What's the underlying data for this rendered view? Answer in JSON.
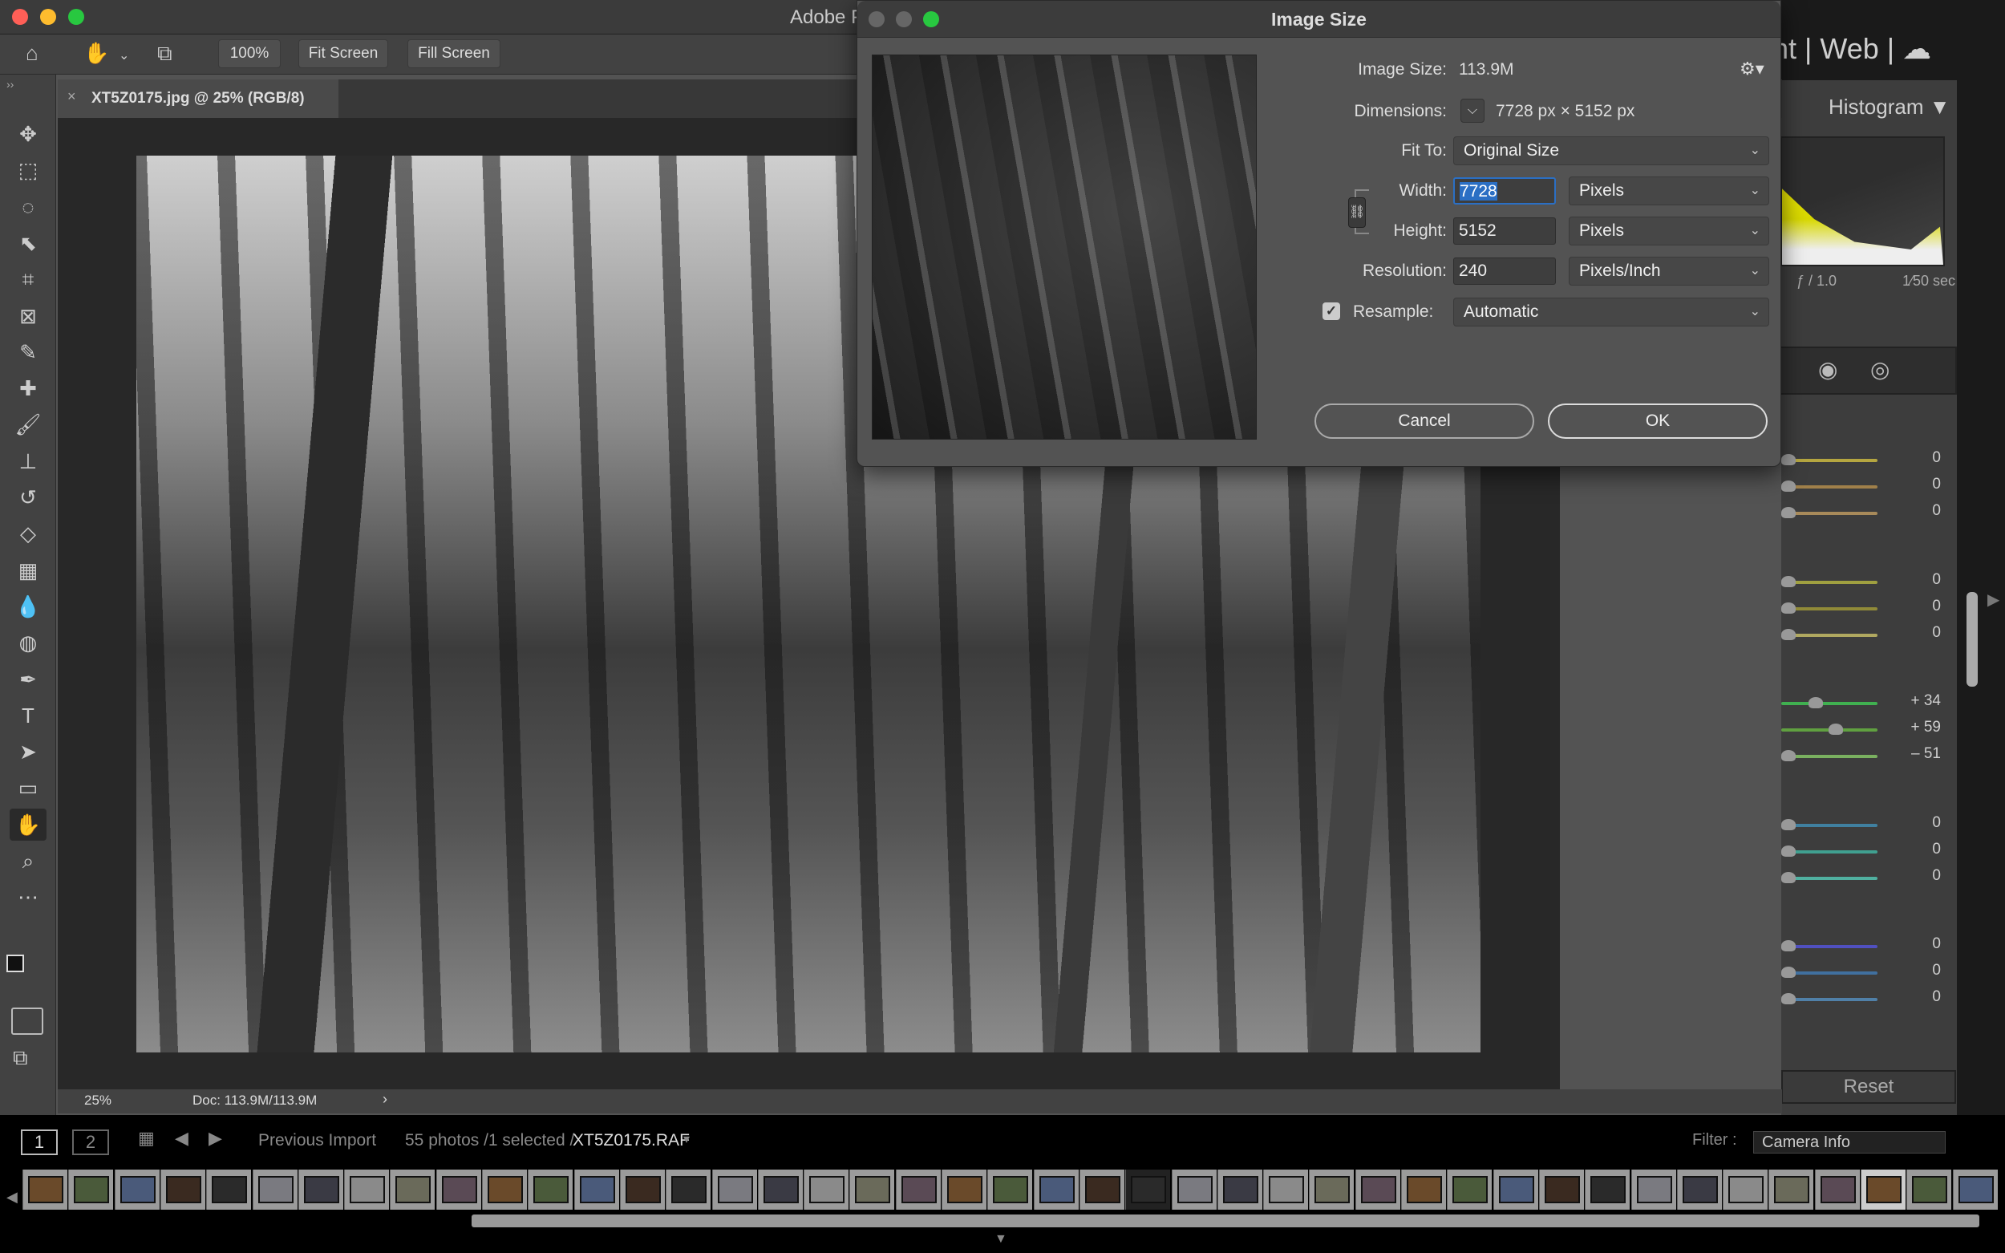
{
  "photoshop": {
    "title": "Adobe P",
    "options": {
      "zoom_label": "100%",
      "fit_screen": "Fit Screen",
      "fill_screen": "Fill Screen"
    },
    "tab": {
      "title": "XT5Z0175.jpg @ 25% (RGB/8)",
      "close": "×"
    },
    "tools": [
      {
        "name": "move-tool",
        "glyph": "✥"
      },
      {
        "name": "marquee-tool",
        "glyph": "⬚"
      },
      {
        "name": "lasso-tool",
        "glyph": "◌"
      },
      {
        "name": "object-selection-tool",
        "glyph": "⬉"
      },
      {
        "name": "crop-tool",
        "glyph": "⌗"
      },
      {
        "name": "frame-tool",
        "glyph": "⊠"
      },
      {
        "name": "eyedropper-tool",
        "glyph": "✎"
      },
      {
        "name": "healing-brush-tool",
        "glyph": "✚"
      },
      {
        "name": "brush-tool",
        "glyph": "🖌"
      },
      {
        "name": "clone-stamp-tool",
        "glyph": "⊥"
      },
      {
        "name": "history-brush-tool",
        "glyph": "↺"
      },
      {
        "name": "eraser-tool",
        "glyph": "◇"
      },
      {
        "name": "gradient-tool",
        "glyph": "▦"
      },
      {
        "name": "blur-tool",
        "glyph": "💧"
      },
      {
        "name": "dodge-tool",
        "glyph": "◍"
      },
      {
        "name": "pen-tool",
        "glyph": "✒"
      },
      {
        "name": "type-tool",
        "glyph": "T"
      },
      {
        "name": "path-selection-tool",
        "glyph": "➤"
      },
      {
        "name": "rectangle-tool",
        "glyph": "▭"
      },
      {
        "name": "hand-tool",
        "glyph": "✋"
      },
      {
        "name": "zoom-tool",
        "glyph": "⌕"
      },
      {
        "name": "more-tools",
        "glyph": "⋯"
      }
    ],
    "active_tool": "hand-tool",
    "status": {
      "zoom": "25%",
      "doc": "Doc: 113.9M/113.9M",
      "arrow": "›"
    }
  },
  "dialog": {
    "title": "Image Size",
    "image_size_label": "Image Size:",
    "image_size_value": "113.9M",
    "dimensions_label": "Dimensions:",
    "dimensions_value": "7728 px  ×  5152 px",
    "fit_to_label": "Fit To:",
    "fit_to_value": "Original Size",
    "width_label": "Width:",
    "width_value": "7728",
    "width_unit": "Pixels",
    "height_label": "Height:",
    "height_value": "5152",
    "height_unit": "Pixels",
    "resolution_label": "Resolution:",
    "resolution_value": "240",
    "resolution_unit": "Pixels/Inch",
    "resample_label": "Resample:",
    "resample_checked": true,
    "resample_value": "Automatic",
    "cancel": "Cancel",
    "ok": "OK",
    "accent": "#2b6fc4"
  },
  "lightroom": {
    "modules": "rint  |  Web  |",
    "histogram_title": "Histogram ▼",
    "aperture": "ƒ / 1.0",
    "shutter": "1⁄50 sec",
    "slider_groups": [
      {
        "colors": [
          "#b5a640",
          "#a0804a",
          "#a88a5a"
        ],
        "values": [
          "0",
          "0",
          "0"
        ],
        "levels": [
          0,
          0,
          0
        ]
      },
      {
        "colors": [
          "#a0a040",
          "#908a38",
          "#b0a860"
        ],
        "values": [
          "0",
          "0",
          "0"
        ],
        "levels": [
          0,
          0,
          0
        ]
      },
      {
        "colors": [
          "#40b050",
          "#60a040",
          "#7ab060"
        ],
        "values": [
          "+ 34",
          "+ 59",
          "– 51"
        ],
        "levels": [
          34,
          59,
          -51
        ]
      },
      {
        "colors": [
          "#4080a0",
          "#40a090",
          "#50b0a0"
        ],
        "values": [
          "0",
          "0",
          "0"
        ],
        "levels": [
          0,
          0,
          0
        ]
      },
      {
        "colors": [
          "#5050c0",
          "#4070a0",
          "#5080a8"
        ],
        "values": [
          "0",
          "0",
          "0"
        ],
        "levels": [
          0,
          0,
          0
        ]
      }
    ],
    "reset": "Reset",
    "filmstrip": {
      "view1": "1",
      "view2": "2",
      "source": "Previous Import",
      "count": "55 photos /1 selected /",
      "filename": "XT5Z0175.RAF",
      "dropdown": "▾",
      "filter_label": "Filter :",
      "filter_value": "Camera Info"
    }
  }
}
